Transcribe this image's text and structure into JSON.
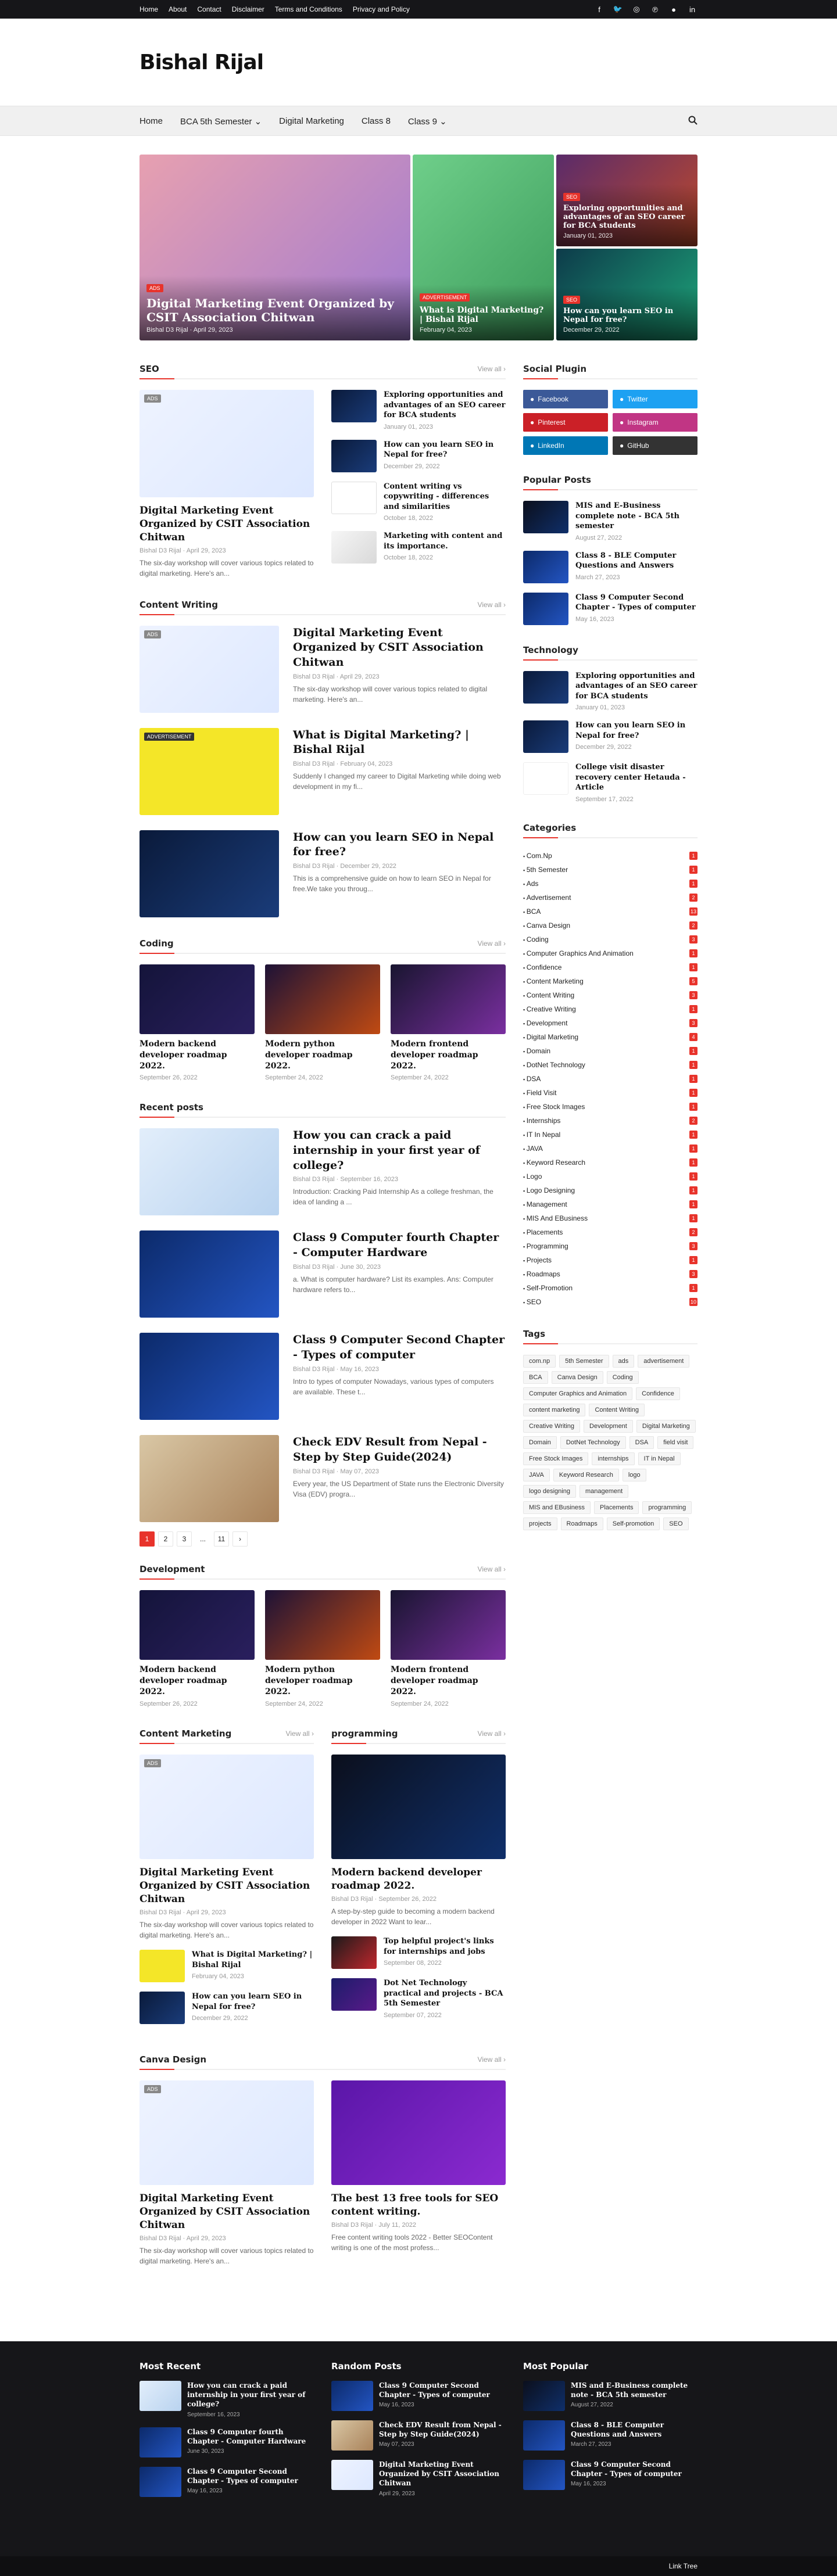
{
  "topbar": {
    "links": [
      "Home",
      "About",
      "Contact",
      "Disclaimer",
      "Terms and Conditions",
      "Privacy and Policy"
    ],
    "social_icons": [
      "facebook-icon",
      "twitter-icon",
      "instagram-icon",
      "pinterest-icon",
      "github-icon",
      "linkedin-icon"
    ]
  },
  "header": {
    "logo": "Bishal Rijal"
  },
  "nav": {
    "items": [
      "Home",
      "BCA 5th Semester",
      "Digital Marketing",
      "Class 8",
      "Class 9"
    ],
    "search_icon": "search-icon"
  },
  "hero": {
    "big": {
      "tag": "ads",
      "title": "Digital Marketing Event Organized by CSIT Association Chitwan",
      "author": "Bishal D3 Rijal",
      "date": "April 29, 2023"
    },
    "mid": {
      "tag": "Advertisement",
      "title": "What is Digital Marketing? | Bishal Rijal",
      "date": "February 04, 2023"
    },
    "top_right": {
      "tag": "SEO",
      "title": "Exploring opportunities and advantages of an SEO career for BCA students",
      "date": "January 01, 2023"
    },
    "bottom_right": {
      "tag": "SEO",
      "title": "How can you learn SEO in Nepal for free?",
      "date": "December 29, 2022"
    }
  },
  "seo": {
    "title": "SEO",
    "view_all": "View all ›",
    "main": {
      "tag": "ads",
      "title": "Digital Marketing Event Organized by CSIT Association Chitwan",
      "author": "Bishal D3 Rijal",
      "date": "April 29, 2023",
      "snippet": "The six-day workshop will cover various topics related to digital marketing. Here's an..."
    },
    "list": [
      {
        "title": "Exploring opportunities and advantages of an SEO career for BCA students",
        "date": "January 01, 2023"
      },
      {
        "title": "How can you learn SEO in Nepal for free?",
        "date": "December 29, 2022"
      },
      {
        "title": "Content writing vs copywriting - differences and similarities",
        "date": "October 18, 2022"
      },
      {
        "title": "Marketing with content and its importance.",
        "date": "October 18, 2022"
      }
    ]
  },
  "content_writing": {
    "title": "Content Writing",
    "view_all": "View all ›",
    "posts": [
      {
        "tag": "ads",
        "title": "Digital Marketing Event Organized by CSIT Association Chitwan",
        "author": "Bishal D3 Rijal",
        "date": "April 29, 2023",
        "snippet": "The six-day workshop will cover various topics related to digital marketing. Here's an..."
      },
      {
        "tag": "Advertisement",
        "title": "What is Digital Marketing? | Bishal Rijal",
        "author": "Bishal D3 Rijal",
        "date": "February 04, 2023",
        "snippet": "Suddenly I changed my career to Digital Marketing while doing web development in my fi..."
      },
      {
        "tag": "",
        "title": "How can you learn SEO in Nepal for free?",
        "author": "Bishal D3 Rijal",
        "date": "December 29, 2022",
        "snippet": "This is a comprehensive guide on how to learn SEO in Nepal for free.We take you throug..."
      }
    ]
  },
  "coding": {
    "title": "Coding",
    "view_all": "View all ›",
    "posts": [
      {
        "title": "Modern backend developer roadmap 2022.",
        "date": "September 26, 2022"
      },
      {
        "title": "Modern python developer roadmap 2022.",
        "date": "September 24, 2022"
      },
      {
        "title": "Modern frontend developer roadmap 2022.",
        "date": "September 24, 2022"
      }
    ]
  },
  "recent": {
    "title": "Recent posts",
    "posts": [
      {
        "title": "How you can crack a paid internship in your first year of college?",
        "author": "Bishal D3 Rijal",
        "date": "September 16, 2023",
        "snippet": "Introduction: Cracking Paid Internship As a college freshman, the idea of landing a ..."
      },
      {
        "title": "Class 9 Computer fourth Chapter - Computer Hardware",
        "author": "Bishal D3 Rijal",
        "date": "June 30, 2023",
        "snippet": "a. What is computer hardware? List its examples. Ans: Computer hardware refers to..."
      },
      {
        "title": "Class 9 Computer Second Chapter - Types of computer",
        "author": "Bishal D3 Rijal",
        "date": "May 16, 2023",
        "snippet": "Intro to types of computer Nowadays, various types of computers are available. These t..."
      },
      {
        "title": "Check EDV Result from Nepal - Step by Step Guide(2024)",
        "author": "Bishal D3 Rijal",
        "date": "May 07, 2023",
        "snippet": "Every year, the US Department of State runs the Electronic Diversity Visa (EDV) progra..."
      }
    ],
    "pager": [
      "1",
      "2",
      "3",
      "...",
      "11",
      "›"
    ]
  },
  "development": {
    "title": "Development",
    "view_all": "View all ›",
    "posts": [
      {
        "title": "Modern backend developer roadmap 2022.",
        "date": "September 26, 2022"
      },
      {
        "title": "Modern python developer roadmap 2022.",
        "date": "September 24, 2022"
      },
      {
        "title": "Modern frontend developer roadmap 2022.",
        "date": "September 24, 2022"
      }
    ]
  },
  "content_marketing": {
    "title": "Content Marketing",
    "view_all": "View all ›",
    "main": {
      "tag": "ads",
      "title": "Digital Marketing Event Organized by CSIT Association Chitwan",
      "author": "Bishal D3 Rijal",
      "date": "April 29, 2023",
      "snippet": "The six-day workshop will cover various topics related to digital marketing. Here's an..."
    },
    "list": [
      {
        "title": "What is Digital Marketing? | Bishal Rijal",
        "date": "February 04, 2023"
      },
      {
        "title": "How can you learn SEO in Nepal for free?",
        "date": "December 29, 2022"
      }
    ]
  },
  "programming": {
    "title": "programming",
    "view_all": "View all ›",
    "main": {
      "title": "Modern backend developer roadmap 2022.",
      "author": "Bishal D3 Rijal",
      "date": "September 26, 2022",
      "snippet": "A step-by-step guide to becoming a modern backend developer in 2022 Want to lear..."
    },
    "list": [
      {
        "title": "Top helpful project's links for internships and jobs",
        "date": "September 08, 2022"
      },
      {
        "title": "Dot Net Technology practical and projects - BCA 5th Semester",
        "date": "September 07, 2022"
      }
    ]
  },
  "canva": {
    "title": "Canva Design",
    "view_all": "View all ›",
    "posts": [
      {
        "tag": "ads",
        "title": "Digital Marketing Event Organized by CSIT Association Chitwan",
        "author": "Bishal D3 Rijal",
        "date": "April 29, 2023",
        "snippet": "The six-day workshop will cover various topics related to digital marketing. Here's an..."
      },
      {
        "tag": "",
        "title": "The best 13 free tools for SEO content writing.",
        "author": "Bishal D3 Rijal",
        "date": "July 11, 2022",
        "snippet": "Free content writing tools 2022 - Better SEOContent writing is one of the most profess..."
      }
    ]
  },
  "sidebar": {
    "social_title": "Social Plugin",
    "social": [
      {
        "label": "Facebook",
        "color": "#3b5998",
        "icon": "facebook-icon"
      },
      {
        "label": "Twitter",
        "color": "#1da1f2",
        "icon": "twitter-icon"
      },
      {
        "label": "Pinterest",
        "color": "#cb2027",
        "icon": "pinterest-icon"
      },
      {
        "label": "Instagram",
        "color": "#c13584",
        "icon": "instagram-icon"
      },
      {
        "label": "LinkedIn",
        "color": "#0077b5",
        "icon": "linkedin-icon"
      },
      {
        "label": "GitHub",
        "color": "#333333",
        "icon": "github-icon"
      }
    ],
    "popular_title": "Popular Posts",
    "popular": [
      {
        "title": "MIS and E-Business complete note - BCA 5th semester",
        "date": "August 27, 2022"
      },
      {
        "title": "Class 8 - BLE Computer Questions and Answers",
        "date": "March 27, 2023"
      },
      {
        "title": "Class 9 Computer Second Chapter - Types of computer",
        "date": "May 16, 2023"
      }
    ],
    "tech_title": "Technology",
    "tech": [
      {
        "title": "Exploring opportunities and advantages of an SEO career for BCA students",
        "date": "January 01, 2023"
      },
      {
        "title": "How can you learn SEO in Nepal for free?",
        "date": "December 29, 2022"
      },
      {
        "title": "College visit disaster recovery center Hetauda - Article",
        "date": "September 17, 2022"
      }
    ],
    "categories_title": "Categories",
    "categories": [
      {
        "name": "Com.Np",
        "count": "1"
      },
      {
        "name": "5th Semester",
        "count": "1"
      },
      {
        "name": "Ads",
        "count": "1"
      },
      {
        "name": "Advertisement",
        "count": "2"
      },
      {
        "name": "BCA",
        "count": "13"
      },
      {
        "name": "Canva Design",
        "count": "2"
      },
      {
        "name": "Coding",
        "count": "3"
      },
      {
        "name": "Computer Graphics And Animation",
        "count": "1"
      },
      {
        "name": "Confidence",
        "count": "1"
      },
      {
        "name": "Content Marketing",
        "count": "5"
      },
      {
        "name": "Content Writing",
        "count": "3"
      },
      {
        "name": "Creative Writing",
        "count": "1"
      },
      {
        "name": "Development",
        "count": "3"
      },
      {
        "name": "Digital Marketing",
        "count": "4"
      },
      {
        "name": "Domain",
        "count": "1"
      },
      {
        "name": "DotNet Technology",
        "count": "1"
      },
      {
        "name": "DSA",
        "count": "1"
      },
      {
        "name": "Field Visit",
        "count": "1"
      },
      {
        "name": "Free Stock Images",
        "count": "1"
      },
      {
        "name": "Internships",
        "count": "2"
      },
      {
        "name": "IT In Nepal",
        "count": "1"
      },
      {
        "name": "JAVA",
        "count": "1"
      },
      {
        "name": "Keyword Research",
        "count": "1"
      },
      {
        "name": "Logo",
        "count": "1"
      },
      {
        "name": "Logo Designing",
        "count": "1"
      },
      {
        "name": "Management",
        "count": "1"
      },
      {
        "name": "MIS And EBusiness",
        "count": "1"
      },
      {
        "name": "Placements",
        "count": "2"
      },
      {
        "name": "Programming",
        "count": "3"
      },
      {
        "name": "Projects",
        "count": "1"
      },
      {
        "name": "Roadmaps",
        "count": "3"
      },
      {
        "name": "Self-Promotion",
        "count": "1"
      },
      {
        "name": "SEO",
        "count": "10"
      }
    ],
    "tags_title": "Tags",
    "tags": [
      "com.np",
      "5th Semester",
      "ads",
      "advertisement",
      "BCA",
      "Canva Design",
      "Coding",
      "Computer Graphics and Animation",
      "Confidence",
      "content marketing",
      "Content Writing",
      "Creative Writing",
      "Development",
      "Digital Marketing",
      "Domain",
      "DotNet Technology",
      "DSA",
      "field visit",
      "Free Stock Images",
      "internships",
      "IT in Nepal",
      "JAVA",
      "Keyword Research",
      "logo",
      "logo designing",
      "management",
      "MIS and EBusiness",
      "Placements",
      "programming",
      "projects",
      "Roadmaps",
      "Self-promotion",
      "SEO"
    ]
  },
  "footer": {
    "most_recent_title": "Most Recent",
    "most_recent": [
      {
        "title": "How you can crack a paid internship in your first year of college?",
        "date": "September 16, 2023"
      },
      {
        "title": "Class 9 Computer fourth Chapter - Computer Hardware",
        "date": "June 30, 2023"
      },
      {
        "title": "Class 9 Computer Second Chapter - Types of computer",
        "date": "May 16, 2023"
      }
    ],
    "random_title": "Random Posts",
    "random": [
      {
        "title": "Class 9 Computer Second Chapter - Types of computer",
        "date": "May 16, 2023"
      },
      {
        "title": "Check EDV Result from Nepal - Step by Step Guide(2024)",
        "date": "May 07, 2023"
      },
      {
        "title": "Digital Marketing Event Organized by CSIT Association Chitwan",
        "date": "April 29, 2023"
      }
    ],
    "popular_title": "Most Popular",
    "popular": [
      {
        "title": "MIS and E-Business complete note - BCA 5th semester",
        "date": "August 27, 2022"
      },
      {
        "title": "Class 8 - BLE Computer Questions and Answers",
        "date": "March 27, 2023"
      },
      {
        "title": "Class 9 Computer Second Chapter - Types of computer",
        "date": "May 16, 2023"
      }
    ],
    "link_tree": "Link Tree"
  },
  "colors": {
    "accent": "#e8332b",
    "dark": "#161619"
  }
}
